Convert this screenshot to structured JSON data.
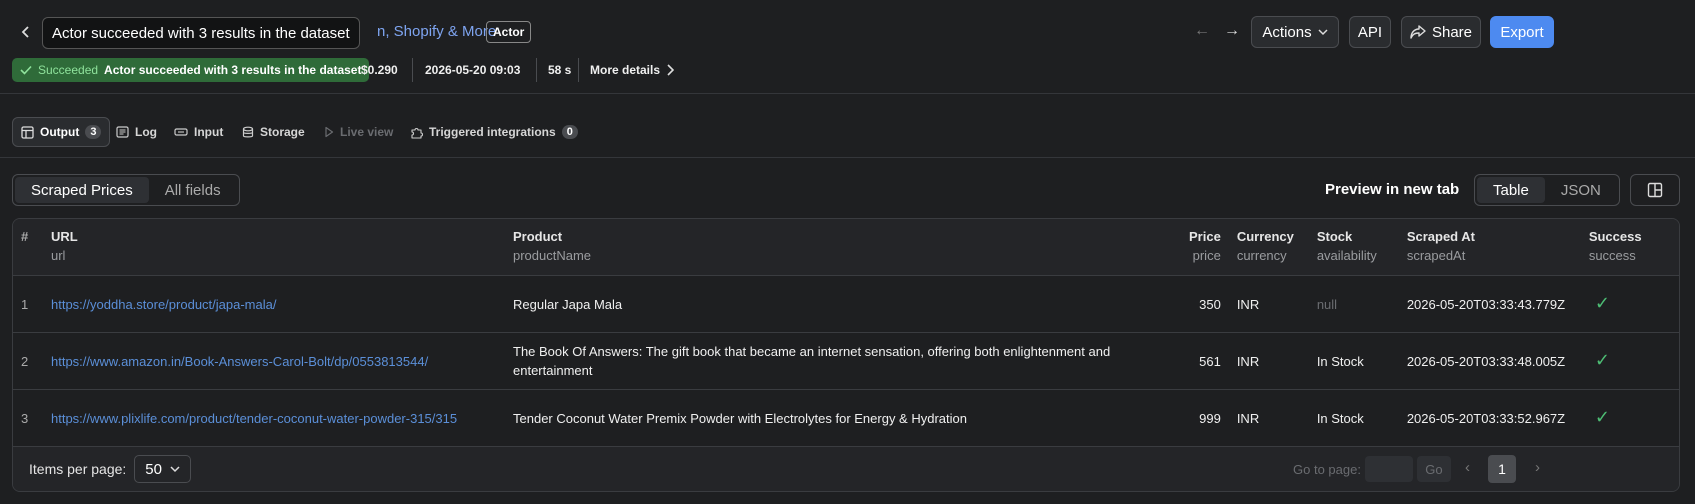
{
  "header": {
    "tooltip": "Actor succeeded with 3 results in the dataset",
    "title_fragment": "n, Shopify & More",
    "actor_badge": "Actor",
    "buttons": {
      "actions": "Actions",
      "api": "API",
      "share": "Share",
      "export": "Export"
    }
  },
  "status": {
    "state": "Succeeded",
    "message": "Actor succeeded with 3 results in the dataset",
    "cost": "$0.290",
    "started": "2026-05-20 09:03",
    "duration": "58 s",
    "more_details": "More details"
  },
  "tabs": [
    {
      "label": "Output",
      "count": "3"
    },
    {
      "label": "Log"
    },
    {
      "label": "Input"
    },
    {
      "label": "Storage"
    },
    {
      "label": "Live view"
    },
    {
      "label": "Triggered integrations",
      "count": "0"
    }
  ],
  "views": {
    "scraped_prices": "Scraped Prices",
    "all_fields": "All fields"
  },
  "preview_link": "Preview in new tab",
  "format": {
    "table": "Table",
    "json": "JSON"
  },
  "table": {
    "columns": [
      {
        "title": "#",
        "sub": ""
      },
      {
        "title": "URL",
        "sub": "url"
      },
      {
        "title": "Product",
        "sub": "productName"
      },
      {
        "title": "Price",
        "sub": "price"
      },
      {
        "title": "Currency",
        "sub": "currency"
      },
      {
        "title": "Stock",
        "sub": "availability"
      },
      {
        "title": "Scraped At",
        "sub": "scrapedAt"
      },
      {
        "title": "Success",
        "sub": "success"
      }
    ],
    "rows": [
      {
        "n": "1",
        "url": "https://yoddha.store/product/japa-mala/",
        "product": "Regular Japa Mala",
        "price": "350",
        "currency": "INR",
        "stock": "null",
        "scraped_at": "2026-05-20T03:33:43.779Z"
      },
      {
        "n": "2",
        "url": "https://www.amazon.in/Book-Answers-Carol-Bolt/dp/0553813544/",
        "product": "The Book Of Answers: The gift book that became an internet sensation, offering both enlightenment and entertainment",
        "price": "561",
        "currency": "INR",
        "stock": "In Stock",
        "scraped_at": "2026-05-20T03:33:48.005Z"
      },
      {
        "n": "3",
        "url": "https://www.plixlife.com/product/tender-coconut-water-powder-315/315",
        "product": "Tender Coconut Water Premix Powder with Electrolytes for Energy & Hydration",
        "price": "999",
        "currency": "INR",
        "stock": "In Stock",
        "scraped_at": "2026-05-20T03:33:52.967Z"
      }
    ]
  },
  "footer": {
    "items_per_page_label": "Items per page:",
    "items_per_page": "50",
    "goto_label": "Go to page:",
    "go_button": "Go",
    "current_page": "1"
  },
  "colors": {
    "accent": "#4d8af0",
    "success": "#4dbd74",
    "status_bg": "#2f6b39"
  }
}
